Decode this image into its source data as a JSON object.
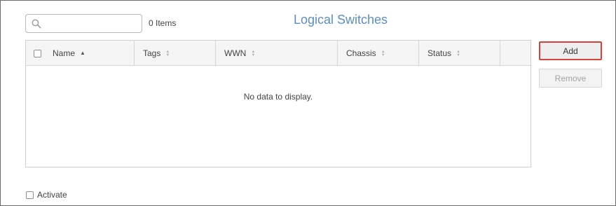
{
  "search": {
    "placeholder": "",
    "value": ""
  },
  "item_count": "0 Items",
  "title": "Logical Switches",
  "table": {
    "columns": [
      {
        "label": "Name",
        "sort": "ascending"
      },
      {
        "label": "Tags",
        "sort": "none"
      },
      {
        "label": "WWN",
        "sort": "none"
      },
      {
        "label": "Chassis",
        "sort": "none"
      },
      {
        "label": "Status",
        "sort": "none"
      }
    ],
    "rows": [],
    "empty_message": "No data to display."
  },
  "actions": {
    "add_label": "Add",
    "remove_label": "Remove"
  },
  "activate": {
    "label": "Activate",
    "checked": false
  },
  "colors": {
    "title": "#5b8ec4",
    "add_highlight": "#d9423c",
    "header_bg": "#f5f5f5"
  },
  "icons": {
    "search": "search-icon",
    "sort_asc": "sort-asc-icon",
    "sort_none": "sort-icon"
  }
}
